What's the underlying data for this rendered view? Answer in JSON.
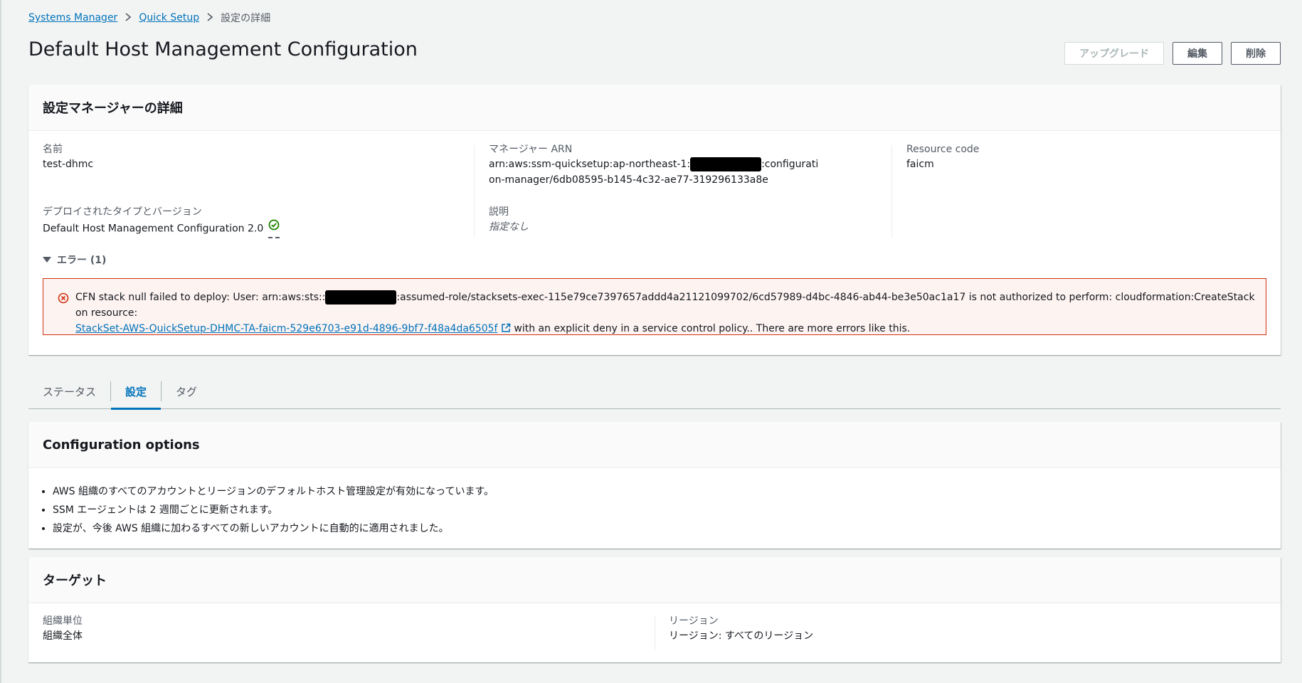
{
  "breadcrumb": {
    "items": [
      {
        "label": "Systems Manager"
      },
      {
        "label": "Quick Setup"
      },
      {
        "label": "設定の詳細"
      }
    ]
  },
  "header": {
    "title": "Default Host Management Configuration",
    "buttons": {
      "upgrade": "アップグレード",
      "edit": "編集",
      "delete": "削除"
    }
  },
  "details": {
    "title": "設定マネージャーの詳細",
    "name_label": "名前",
    "name_value": "test-dhmc",
    "arn_label": "マネージャー ARN",
    "arn_prefix": "arn:aws:ssm-quicksetup:ap-northeast-1:",
    "arn_suffix": ":configuration-manager/6db08595-b145-4c32-ae77-319296133a8e",
    "resource_code_label": "Resource code",
    "resource_code_value": "faicm",
    "deployed_label": "デプロイされたタイプとバージョン",
    "deployed_value": "Default Host Management Configuration 2.0",
    "description_label": "説明",
    "description_value": "指定なし",
    "errors_label": "エラー (1)",
    "error": {
      "part1": "CFN stack null failed to deploy: User: arn:aws:sts::",
      "part2": ":assumed-role/stacksets-exec-115e79ce7397657addd4a21121099702/6cd57989-d4bc-4846-ab44-be3e50ac1a17 is not authorized to perform: cloudformation:CreateStack on resource:",
      "link": "StackSet-AWS-QuickSetup-DHMC-TA-faicm-529e6703-e91d-4896-9bf7-f48a4da6505f",
      "part3": "with an explicit deny in a service control policy.. There are more errors like this."
    }
  },
  "tabs": [
    {
      "label": "ステータス",
      "active": false
    },
    {
      "label": "設定",
      "active": true
    },
    {
      "label": "タグ",
      "active": false
    }
  ],
  "config": {
    "title": "Configuration options",
    "items": [
      "AWS 組織のすべてのアカウントとリージョンのデフォルトホスト管理設定が有効になっています。",
      "SSM エージェントは 2 週間ごとに更新されます。",
      "設定が、今後 AWS 組織に加わるすべての新しいアカウントに自動的に適用されました。"
    ]
  },
  "targets": {
    "title": "ターゲット",
    "ou_label": "組織単位",
    "ou_value": "組織全体",
    "region_label": "リージョン",
    "region_value": "リージョン: すべてのリージョン"
  },
  "colors": {
    "link": "#0073bb",
    "error_border": "#d13212",
    "error_bg": "#fdf3f1",
    "success": "#1d8102"
  },
  "icons": {
    "breadcrumb_separator": "chevron-right-icon",
    "status": "check-circle-icon",
    "error": "error-circle-icon",
    "external": "external-link-icon",
    "expand": "caret-down-icon"
  }
}
